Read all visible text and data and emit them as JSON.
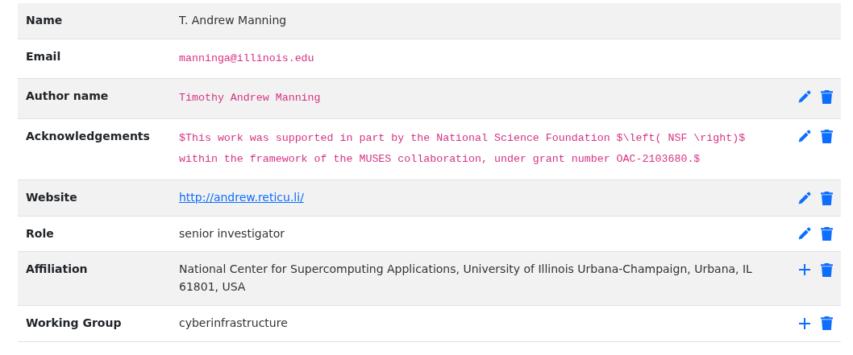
{
  "rows": [
    {
      "label": "Name",
      "value": "T. Andrew Manning",
      "kind": "text",
      "actions": []
    },
    {
      "label": "Email",
      "value": "manninga@illinois.edu",
      "kind": "code",
      "actions": []
    },
    {
      "label": "Author name",
      "value": "Timothy Andrew Manning",
      "kind": "code",
      "actions": [
        {
          "kind": "edit"
        },
        {
          "kind": "delete"
        }
      ]
    },
    {
      "label": "Acknowledgements",
      "value": "$This work was supported in part by the National Science Foundation $\\left( NSF \\right)$ within the framework of the MUSES collaboration, under grant number OAC-2103680.$",
      "kind": "code",
      "actions": [
        {
          "kind": "edit"
        },
        {
          "kind": "delete"
        }
      ]
    },
    {
      "label": "Website",
      "value": "http://andrew.reticu.li/",
      "kind": "link",
      "actions": [
        {
          "kind": "edit"
        },
        {
          "kind": "delete"
        }
      ]
    },
    {
      "label": "Role",
      "value": "senior investigator",
      "kind": "text",
      "actions": [
        {
          "kind": "edit"
        },
        {
          "kind": "delete"
        }
      ]
    },
    {
      "label": "Affiliation",
      "value": "National Center for Supercomputing Applications, University of Illinois Urbana-Champaign, Urbana, IL 61801, USA",
      "kind": "text",
      "actions": [
        {
          "kind": "add"
        },
        {
          "kind": "delete"
        }
      ]
    },
    {
      "label": "Working Group",
      "value": "cyberinfrastructure",
      "kind": "text",
      "actions": [
        {
          "kind": "add"
        },
        {
          "kind": "delete"
        }
      ]
    }
  ]
}
